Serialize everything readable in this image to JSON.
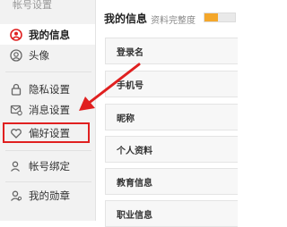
{
  "sidebar": {
    "section_title": "帐号设置",
    "items": [
      {
        "label": "我的信息",
        "icon": "user-circle-icon"
      },
      {
        "label": "头像",
        "icon": "avatar-icon"
      },
      {
        "label": "隐私设置",
        "icon": "lock-icon"
      },
      {
        "label": "消息设置",
        "icon": "message-settings-icon"
      },
      {
        "label": "偏好设置",
        "icon": "heart-icon"
      },
      {
        "label": "帐号绑定",
        "icon": "account-link-icon"
      },
      {
        "label": "我的勋章",
        "icon": "medal-icon"
      }
    ]
  },
  "main": {
    "title": "我的信息",
    "completeness_label": "资料完整度",
    "completeness_value": 0.45,
    "fields": [
      {
        "label": "登录名"
      },
      {
        "label": "手机号"
      },
      {
        "label": "昵称"
      },
      {
        "label": "个人资料"
      },
      {
        "label": "教育信息"
      },
      {
        "label": "职业信息"
      }
    ]
  },
  "colors": {
    "accent_red": "#e02020",
    "progress_fill": "#f4a72b",
    "sidebar_bg": "#f2f2f2"
  }
}
